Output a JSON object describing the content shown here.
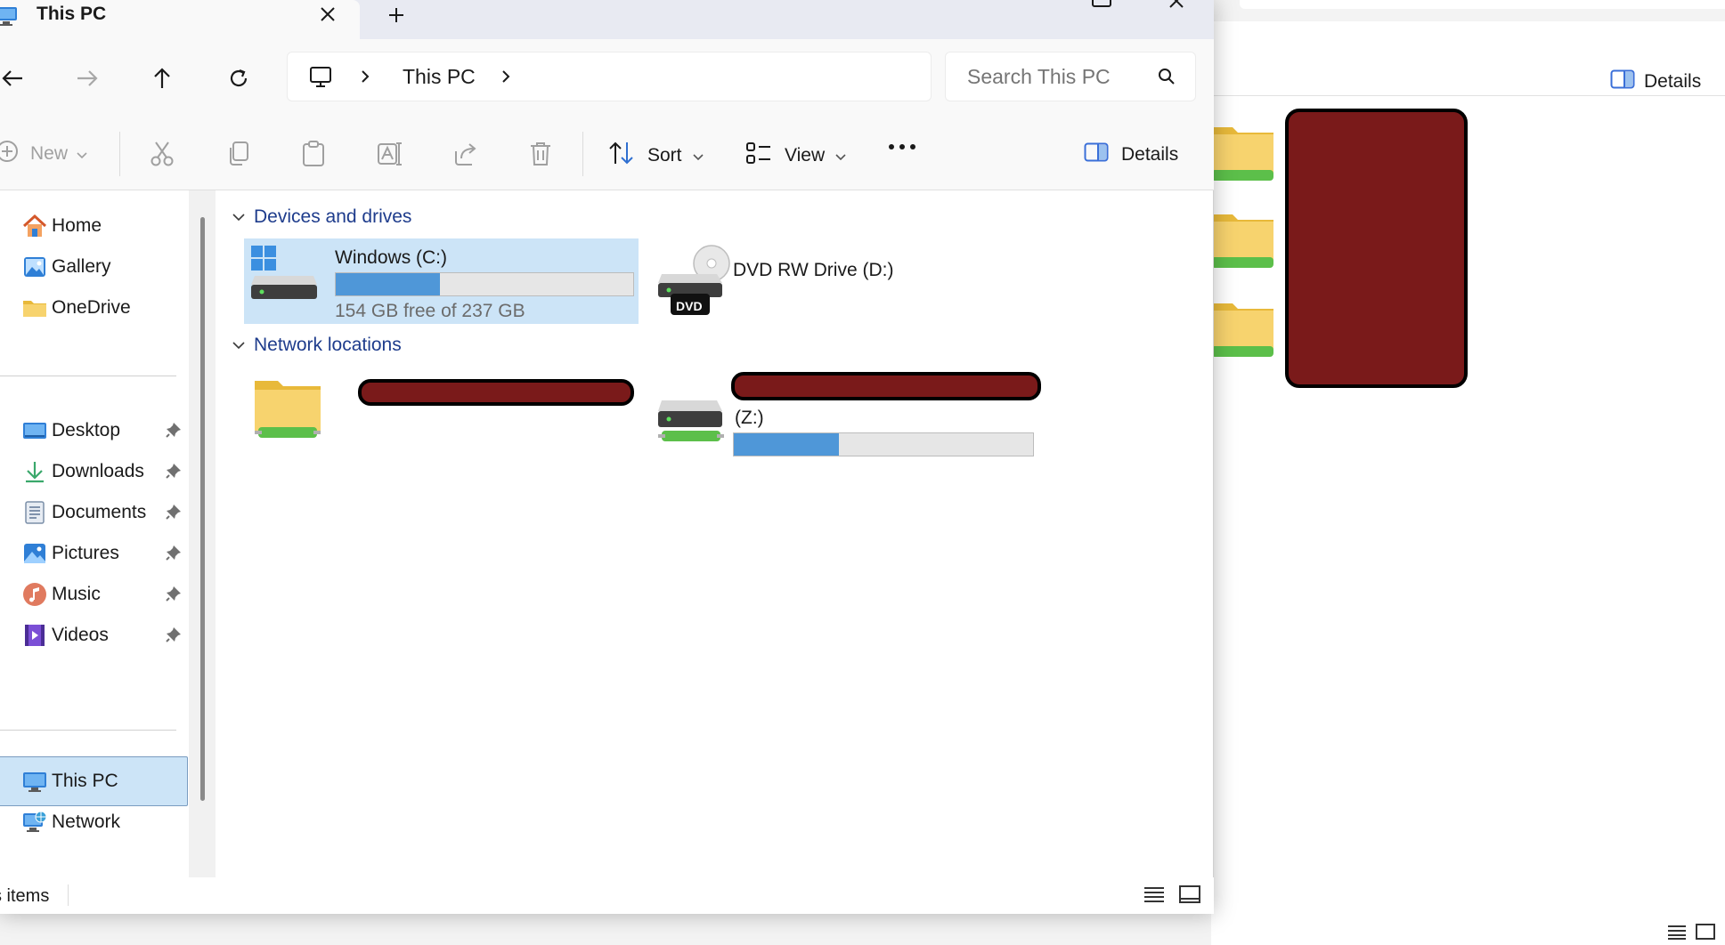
{
  "window": {
    "tab_title": "This PC",
    "tab_close_icon": "close-icon",
    "new_tab_icon": "plus-icon"
  },
  "address": {
    "crumb": "This PC",
    "search_placeholder": "Search This PC"
  },
  "commands": {
    "new_label": "New",
    "sort_label": "Sort",
    "view_label": "View",
    "details_label": "Details"
  },
  "nav": {
    "items": [
      {
        "label": "Home",
        "icon": "home-icon"
      },
      {
        "label": "Gallery",
        "icon": "gallery-icon"
      },
      {
        "label": "OneDrive",
        "icon": "folder-icon"
      },
      {
        "label": "Desktop",
        "icon": "desktop-icon",
        "pinned": true
      },
      {
        "label": "Downloads",
        "icon": "download-icon",
        "pinned": true
      },
      {
        "label": "Documents",
        "icon": "documents-icon",
        "pinned": true
      },
      {
        "label": "Pictures",
        "icon": "pictures-icon",
        "pinned": true
      },
      {
        "label": "Music",
        "icon": "music-icon",
        "pinned": true
      },
      {
        "label": "Videos",
        "icon": "videos-icon",
        "pinned": true
      },
      {
        "label": "This PC",
        "icon": "this-pc-icon",
        "selected": true
      },
      {
        "label": "Network",
        "icon": "network-icon"
      }
    ]
  },
  "content": {
    "devices_header": "Devices and drives",
    "network_header": "Network locations",
    "drive_c": {
      "name": "Windows (C:)",
      "free_text": "154 GB free of 237 GB",
      "used_fraction": 0.35
    },
    "drive_d": {
      "name": "DVD RW Drive (D:)",
      "badge": "DVD"
    },
    "drive_z": {
      "name": "(Z:)",
      "used_fraction": 0.35
    }
  },
  "status": {
    "item_count": "s items"
  },
  "background_window": {
    "details_label": "Details"
  },
  "colors": {
    "accent": "#4f97d8",
    "header_blue": "#1e3c8c",
    "selection": "#cce4f7",
    "redaction": "#7a1a1a"
  }
}
